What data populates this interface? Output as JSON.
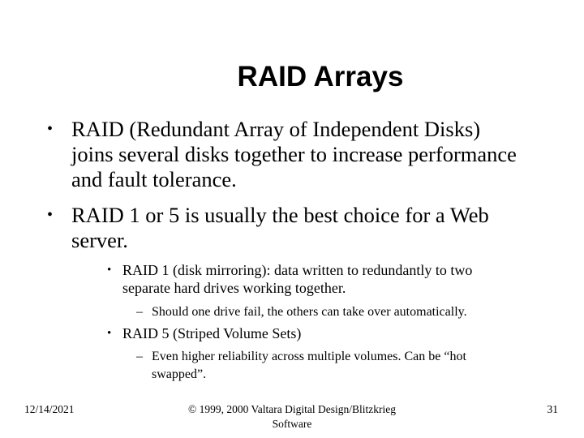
{
  "slide": {
    "title": "RAID Arrays",
    "bullets": [
      {
        "marker": "•",
        "text": "RAID (Redundant Array of Independent Disks) joins several disks together to increase performance and fault tolerance."
      },
      {
        "marker": "•",
        "text": "RAID 1 or 5 is usually the best choice for a Web server."
      }
    ],
    "sub_bullets": [
      {
        "marker": "•",
        "text": "RAID 1 (disk mirroring): data written to redundantly to two separate hard drives working together.",
        "children": [
          {
            "marker": "–",
            "text": "Should one drive fail, the others can take over automatically."
          }
        ]
      },
      {
        "marker": "•",
        "text": "RAID 5 (Striped Volume Sets)",
        "children": [
          {
            "marker": "–",
            "text": "Even higher reliability across multiple volumes. Can be “hot swapped”."
          }
        ]
      }
    ]
  },
  "footer": {
    "date": "12/14/2021",
    "copyright": "© 1999, 2000 Valtara Digital Design/Blitzkrieg Software",
    "page_number": "31"
  }
}
